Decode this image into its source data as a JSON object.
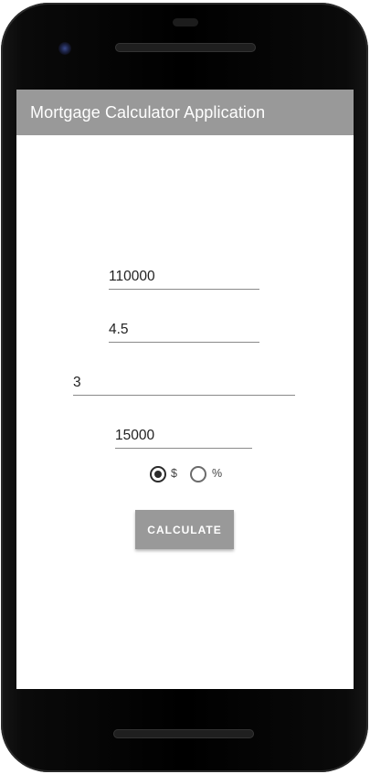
{
  "app_bar": {
    "title": "Mortgage Calculator Application",
    "background_color": "#999999"
  },
  "form": {
    "fields": [
      {
        "value": "110000"
      },
      {
        "value": "4.5"
      },
      {
        "value": "3"
      },
      {
        "value": "15000"
      }
    ],
    "radio_options": [
      {
        "label": "$",
        "checked": true
      },
      {
        "label": "%",
        "checked": false
      }
    ],
    "calculate_label": "CALCULATE",
    "button_color": "#999999"
  },
  "icons": {
    "camera": "camera-icon",
    "speaker": "speaker-icon"
  }
}
